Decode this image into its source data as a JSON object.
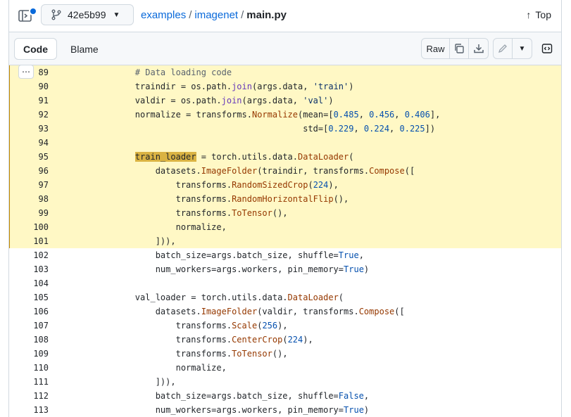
{
  "header": {
    "branch": "42e5b99",
    "breadcrumb": {
      "repo": "examples",
      "folder": "imagenet",
      "file": "main.py",
      "separator": "/"
    },
    "top_label": "Top"
  },
  "toolbar": {
    "tab_code": "Code",
    "tab_blame": "Blame",
    "raw_label": "Raw"
  },
  "colors": {
    "accent": "#0969da",
    "highlight_bg": "#fff8c5",
    "match_bg": "#d4a72c"
  },
  "code_lines": [
    {
      "num": "89",
      "hl": true,
      "tokens": [
        [
          "        ",
          ""
        ],
        [
          "# Data loading code",
          "c"
        ]
      ]
    },
    {
      "num": "90",
      "hl": true,
      "tokens": [
        [
          "        traindir = os.path.",
          ""
        ],
        [
          "join",
          "f"
        ],
        [
          "(args.data, ",
          ""
        ],
        [
          "'train'",
          "s"
        ],
        [
          ")",
          ""
        ]
      ]
    },
    {
      "num": "91",
      "hl": true,
      "tokens": [
        [
          "        valdir = os.path.",
          ""
        ],
        [
          "join",
          "f"
        ],
        [
          "(args.data, ",
          ""
        ],
        [
          "'val'",
          "s"
        ],
        [
          ")",
          ""
        ]
      ]
    },
    {
      "num": "92",
      "hl": true,
      "tokens": [
        [
          "        normalize = transforms.",
          ""
        ],
        [
          "Normalize",
          "m"
        ],
        [
          "(mean=[",
          ""
        ],
        [
          "0.485",
          "n"
        ],
        [
          ", ",
          ""
        ],
        [
          "0.456",
          "n"
        ],
        [
          ", ",
          ""
        ],
        [
          "0.406",
          "n"
        ],
        [
          "],",
          ""
        ]
      ]
    },
    {
      "num": "93",
      "hl": true,
      "tokens": [
        [
          "                                         std=[",
          ""
        ],
        [
          "0.229",
          "n"
        ],
        [
          ", ",
          ""
        ],
        [
          "0.224",
          "n"
        ],
        [
          ", ",
          ""
        ],
        [
          "0.225",
          "n"
        ],
        [
          "])",
          ""
        ]
      ]
    },
    {
      "num": "94",
      "hl": true,
      "tokens": []
    },
    {
      "num": "95",
      "hl": true,
      "tokens": [
        [
          "        ",
          ""
        ],
        [
          "train_loader",
          "hl"
        ],
        [
          " = torch.utils.data.",
          ""
        ],
        [
          "DataLoader",
          "m"
        ],
        [
          "(",
          ""
        ]
      ]
    },
    {
      "num": "96",
      "hl": true,
      "tokens": [
        [
          "            datasets.",
          ""
        ],
        [
          "ImageFolder",
          "m"
        ],
        [
          "(traindir, transforms.",
          ""
        ],
        [
          "Compose",
          "m"
        ],
        [
          "([",
          ""
        ]
      ]
    },
    {
      "num": "97",
      "hl": true,
      "tokens": [
        [
          "                transforms.",
          ""
        ],
        [
          "RandomSizedCrop",
          "m"
        ],
        [
          "(",
          ""
        ],
        [
          "224",
          "n"
        ],
        [
          "),",
          ""
        ]
      ]
    },
    {
      "num": "98",
      "hl": true,
      "tokens": [
        [
          "                transforms.",
          ""
        ],
        [
          "RandomHorizontalFlip",
          "m"
        ],
        [
          "(),",
          ""
        ]
      ]
    },
    {
      "num": "99",
      "hl": true,
      "tokens": [
        [
          "                transforms.",
          ""
        ],
        [
          "ToTensor",
          "m"
        ],
        [
          "(),",
          ""
        ]
      ]
    },
    {
      "num": "100",
      "hl": true,
      "tokens": [
        [
          "                normalize,",
          ""
        ]
      ]
    },
    {
      "num": "101",
      "hl": true,
      "tokens": [
        [
          "            ])),",
          ""
        ]
      ]
    },
    {
      "num": "102",
      "hl": false,
      "tokens": [
        [
          "            batch_size=args.batch_size, shuffle=",
          ""
        ],
        [
          "True",
          "k"
        ],
        [
          ",",
          ""
        ]
      ]
    },
    {
      "num": "103",
      "hl": false,
      "tokens": [
        [
          "            num_workers=args.workers, pin_memory=",
          ""
        ],
        [
          "True",
          "k"
        ],
        [
          ")",
          ""
        ]
      ]
    },
    {
      "num": "104",
      "hl": false,
      "tokens": []
    },
    {
      "num": "105",
      "hl": false,
      "tokens": [
        [
          "        val_loader = torch.utils.data.",
          ""
        ],
        [
          "DataLoader",
          "m"
        ],
        [
          "(",
          ""
        ]
      ]
    },
    {
      "num": "106",
      "hl": false,
      "tokens": [
        [
          "            datasets.",
          ""
        ],
        [
          "ImageFolder",
          "m"
        ],
        [
          "(valdir, transforms.",
          ""
        ],
        [
          "Compose",
          "m"
        ],
        [
          "([",
          ""
        ]
      ]
    },
    {
      "num": "107",
      "hl": false,
      "tokens": [
        [
          "                transforms.",
          ""
        ],
        [
          "Scale",
          "m"
        ],
        [
          "(",
          ""
        ],
        [
          "256",
          "n"
        ],
        [
          "),",
          ""
        ]
      ]
    },
    {
      "num": "108",
      "hl": false,
      "tokens": [
        [
          "                transforms.",
          ""
        ],
        [
          "CenterCrop",
          "m"
        ],
        [
          "(",
          ""
        ],
        [
          "224",
          "n"
        ],
        [
          "),",
          ""
        ]
      ]
    },
    {
      "num": "109",
      "hl": false,
      "tokens": [
        [
          "                transforms.",
          ""
        ],
        [
          "ToTensor",
          "m"
        ],
        [
          "(),",
          ""
        ]
      ]
    },
    {
      "num": "110",
      "hl": false,
      "tokens": [
        [
          "                normalize,",
          ""
        ]
      ]
    },
    {
      "num": "111",
      "hl": false,
      "tokens": [
        [
          "            ])),",
          ""
        ]
      ]
    },
    {
      "num": "112",
      "hl": false,
      "tokens": [
        [
          "            batch_size=args.batch_size, shuffle=",
          ""
        ],
        [
          "False",
          "k"
        ],
        [
          ",",
          ""
        ]
      ]
    },
    {
      "num": "113",
      "hl": false,
      "tokens": [
        [
          "            num_workers=args.workers, pin_memory=",
          ""
        ],
        [
          "True",
          "k"
        ],
        [
          ")",
          ""
        ]
      ]
    }
  ],
  "icons": [
    "sidebar-toggle-icon",
    "git-branch-icon",
    "chevron-down-icon",
    "arrow-up-icon",
    "copy-icon",
    "download-icon",
    "pencil-icon",
    "symbols-panel-icon",
    "kebab-icon"
  ]
}
